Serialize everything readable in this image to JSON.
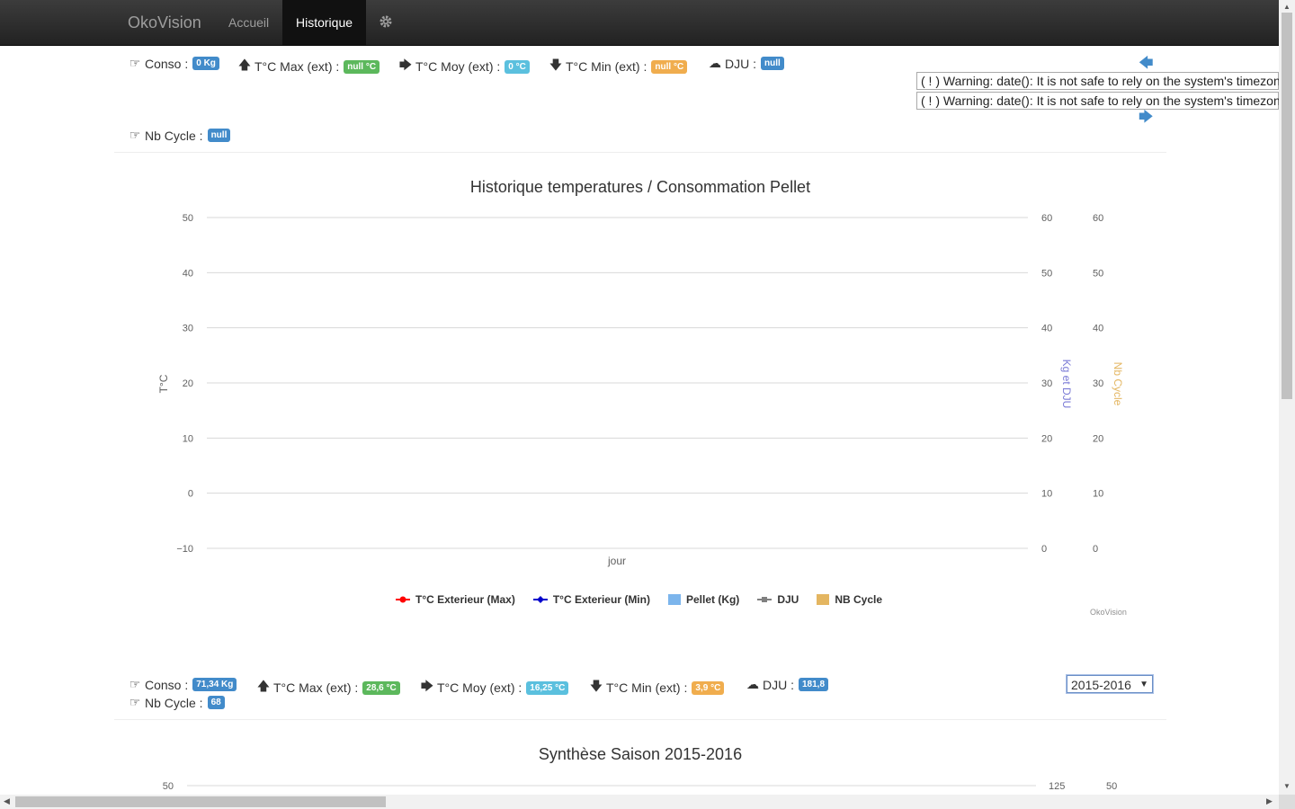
{
  "nav": {
    "brand": "OkoVision",
    "items": [
      {
        "label": "Accueil",
        "active": false
      },
      {
        "label": "Historique",
        "active": true
      }
    ],
    "settings_icon": "gear-icon"
  },
  "day_stats": {
    "conso": {
      "label": "Conso :",
      "value": "0 Kg",
      "icon": "hand-pointer-icon"
    },
    "tmax": {
      "label": "T°C Max (ext) :",
      "value": "null °C",
      "icon": "arrow-up-icon"
    },
    "tmoy": {
      "label": "T°C Moy (ext) :",
      "value": "0 °C",
      "icon": "arrow-right-icon"
    },
    "tmin": {
      "label": "T°C Min (ext) :",
      "value": "null °C",
      "icon": "arrow-down-icon"
    },
    "dju": {
      "label": "DJU :",
      "value": "null",
      "icon": "cloud-icon"
    },
    "nbcycle": {
      "label": "Nb Cycle :",
      "value": "null",
      "icon": "hand-pointer-icon"
    }
  },
  "warnings": [
    "( ! ) Warning: date(): It is not safe to rely on the system's timezone settings",
    "( ! ) Warning: date(): It is not safe to rely on the system's timezone settings"
  ],
  "nav_arrows": {
    "prev": "🡄",
    "next": "🡆"
  },
  "chart_data": {
    "type": "line",
    "title": "Historique temperatures / Consommation Pellet",
    "xlabel": "jour",
    "ylabel": "T°C",
    "y_ticks": [
      "50",
      "40",
      "30",
      "20",
      "10",
      "0",
      "−10"
    ],
    "y2label": "Kg et DJU",
    "y2_ticks": [
      "60",
      "50",
      "40",
      "30",
      "20",
      "10",
      "0"
    ],
    "y3label": "Nb Cycle",
    "y3_ticks": [
      "60",
      "50",
      "40",
      "30",
      "20",
      "10",
      "0"
    ],
    "ylim": [
      -10,
      50
    ],
    "y2lim": [
      0,
      60
    ],
    "y3lim": [
      0,
      60
    ],
    "grid": true,
    "legend_position": "bottom",
    "series": [
      {
        "name": "T°C Exterieur (Max)",
        "color": "#ff0000",
        "values": []
      },
      {
        "name": "T°C Exterieur (Min)",
        "color": "#0000cc",
        "values": []
      },
      {
        "name": "Pellet (Kg)",
        "color": "#7cb5ec",
        "values": []
      },
      {
        "name": "DJU",
        "color": "#808080",
        "values": []
      },
      {
        "name": "NB Cycle",
        "color": "#e4b661",
        "values": []
      }
    ],
    "credits": "OkoVision"
  },
  "season_stats": {
    "conso": {
      "label": "Conso :",
      "value": "71,34 Kg"
    },
    "tmax": {
      "label": "T°C Max (ext) :",
      "value": "28,6 °C"
    },
    "tmoy": {
      "label": "T°C Moy (ext) :",
      "value": "16,25 °C"
    },
    "tmin": {
      "label": "T°C Min (ext) :",
      "value": "3,9 °C"
    },
    "dju": {
      "label": "DJU :",
      "value": "181,8"
    },
    "nbcycle": {
      "label": "Nb Cycle :",
      "value": "68"
    }
  },
  "season_select": {
    "value": "2015-2016"
  },
  "season_chart": {
    "title": "Synthèse Saison 2015-2016",
    "y_top_left": "50",
    "y_top_right": "125",
    "y_top_right2": "50"
  }
}
